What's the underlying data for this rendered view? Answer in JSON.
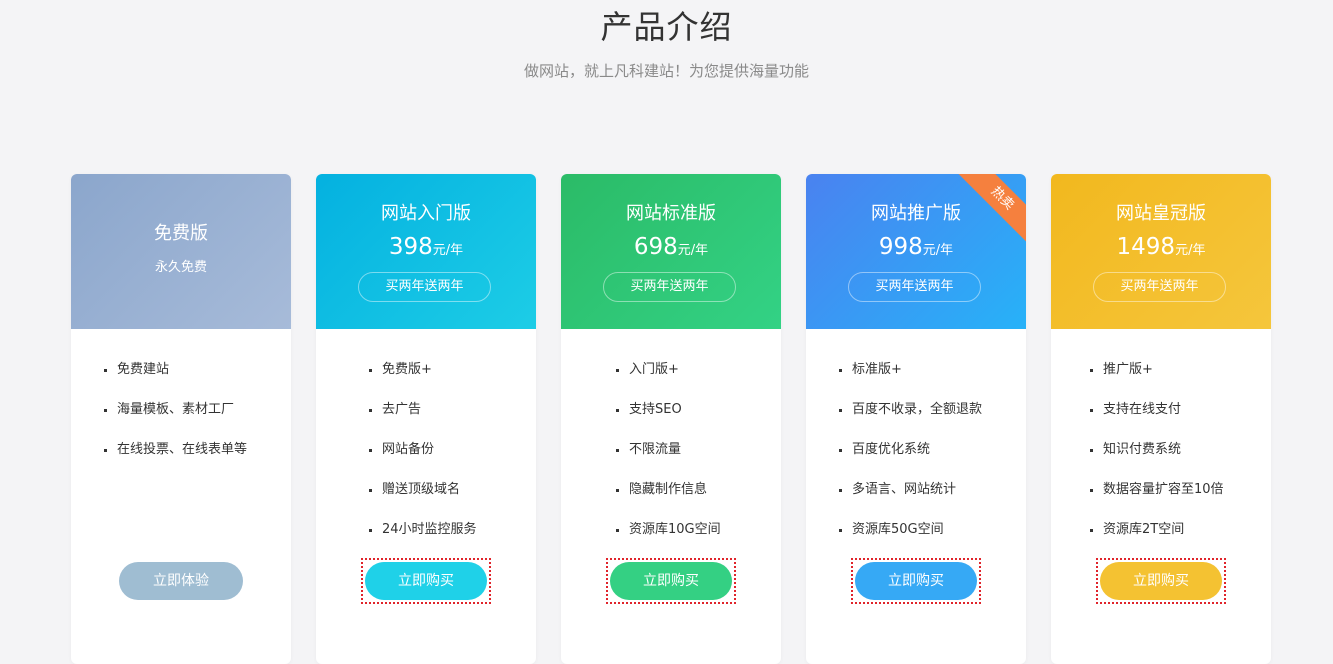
{
  "header": {
    "title": "产品介绍",
    "subtitle": "做网站，就上凡科建站！为您提供海量功能"
  },
  "free_plan": {
    "name": "免费版",
    "sub": "永久免费",
    "features": [
      "免费建站",
      "海量模板、素材工厂",
      "在线投票、在线表单等"
    ],
    "button": "立即体验",
    "color": "#9fbdd2"
  },
  "plans": [
    {
      "name": "网站入门版",
      "price": "398",
      "unit": "元/年",
      "promo": "买两年送两年",
      "features": [
        "免费版+",
        "去广告",
        "网站备份",
        "赠送顶级域名",
        "24小时监控服务"
      ],
      "button": "立即购买",
      "color": "#1fd1e8"
    },
    {
      "name": "网站标准版",
      "price": "698",
      "unit": "元/年",
      "promo": "买两年送两年",
      "features": [
        "入门版+",
        "支持SEO",
        "不限流量",
        "隐藏制作信息",
        "资源库10G空间"
      ],
      "button": "立即购买",
      "color": "#34d083"
    },
    {
      "name": "网站推广版",
      "price": "998",
      "unit": "元/年",
      "promo": "买两年送两年",
      "badge": "热卖",
      "features": [
        "标准版+",
        "百度不收录，全额退款",
        "百度优化系统",
        "多语言、网站统计",
        "资源库50G空间"
      ],
      "button": "立即购买",
      "color": "#36a9f5"
    },
    {
      "name": "网站皇冠版",
      "price": "1498",
      "unit": "元/年",
      "promo": "买两年送两年",
      "features": [
        "推广版+",
        "支持在线支付",
        "知识付费系统",
        "数据容量扩容至10倍",
        "资源库2T空间"
      ],
      "button": "立即购买",
      "color": "#f4c232"
    }
  ]
}
